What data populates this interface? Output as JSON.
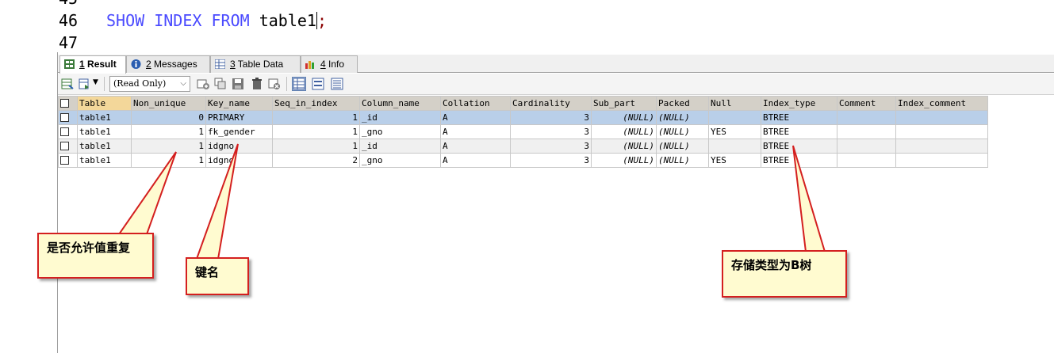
{
  "editor": {
    "line_numbers": [
      "45",
      "46",
      "47"
    ],
    "code": {
      "keyword_show": "SHOW",
      "keyword_index": "INDEX",
      "keyword_from": "FROM",
      "identifier": "table1",
      "terminator": ";"
    }
  },
  "tabs": [
    {
      "num": "1",
      "label": " Result",
      "active": true
    },
    {
      "num": "2",
      "label": " Messages",
      "active": false
    },
    {
      "num": "3",
      "label": " Table Data",
      "active": false
    },
    {
      "num": "4",
      "label": " Info",
      "active": false
    }
  ],
  "toolbar": {
    "mode_select": "(Read Only)"
  },
  "grid": {
    "columns": [
      "Table",
      "Non_unique",
      "Key_name",
      "Seq_in_index",
      "Column_name",
      "Collation",
      "Cardinality",
      "Sub_part",
      "Packed",
      "Null",
      "Index_type",
      "Comment",
      "Index_comment"
    ],
    "rows": [
      [
        "table1",
        "0",
        "PRIMARY",
        "1",
        "_id",
        "A",
        "3",
        "(NULL)",
        "(NULL)",
        "",
        "BTREE",
        "",
        ""
      ],
      [
        "table1",
        "1",
        "fk_gender",
        "1",
        "_gno",
        "A",
        "3",
        "(NULL)",
        "(NULL)",
        "YES",
        "BTREE",
        "",
        ""
      ],
      [
        "table1",
        "1",
        "idgno",
        "1",
        "_id",
        "A",
        "3",
        "(NULL)",
        "(NULL)",
        "",
        "BTREE",
        "",
        ""
      ],
      [
        "table1",
        "1",
        "idgno",
        "2",
        "_gno",
        "A",
        "3",
        "(NULL)",
        "(NULL)",
        "YES",
        "BTREE",
        "",
        ""
      ]
    ]
  },
  "annotations": {
    "non_unique_note": "是否允许值重复",
    "key_name_note": "键名",
    "index_type_note": "存储类型为B树"
  },
  "colors": {
    "keyword": "#4a4aff",
    "callout_border": "#d41f1f",
    "callout_fill": "#fffbd0",
    "selected_row": "#b9cfe9"
  }
}
